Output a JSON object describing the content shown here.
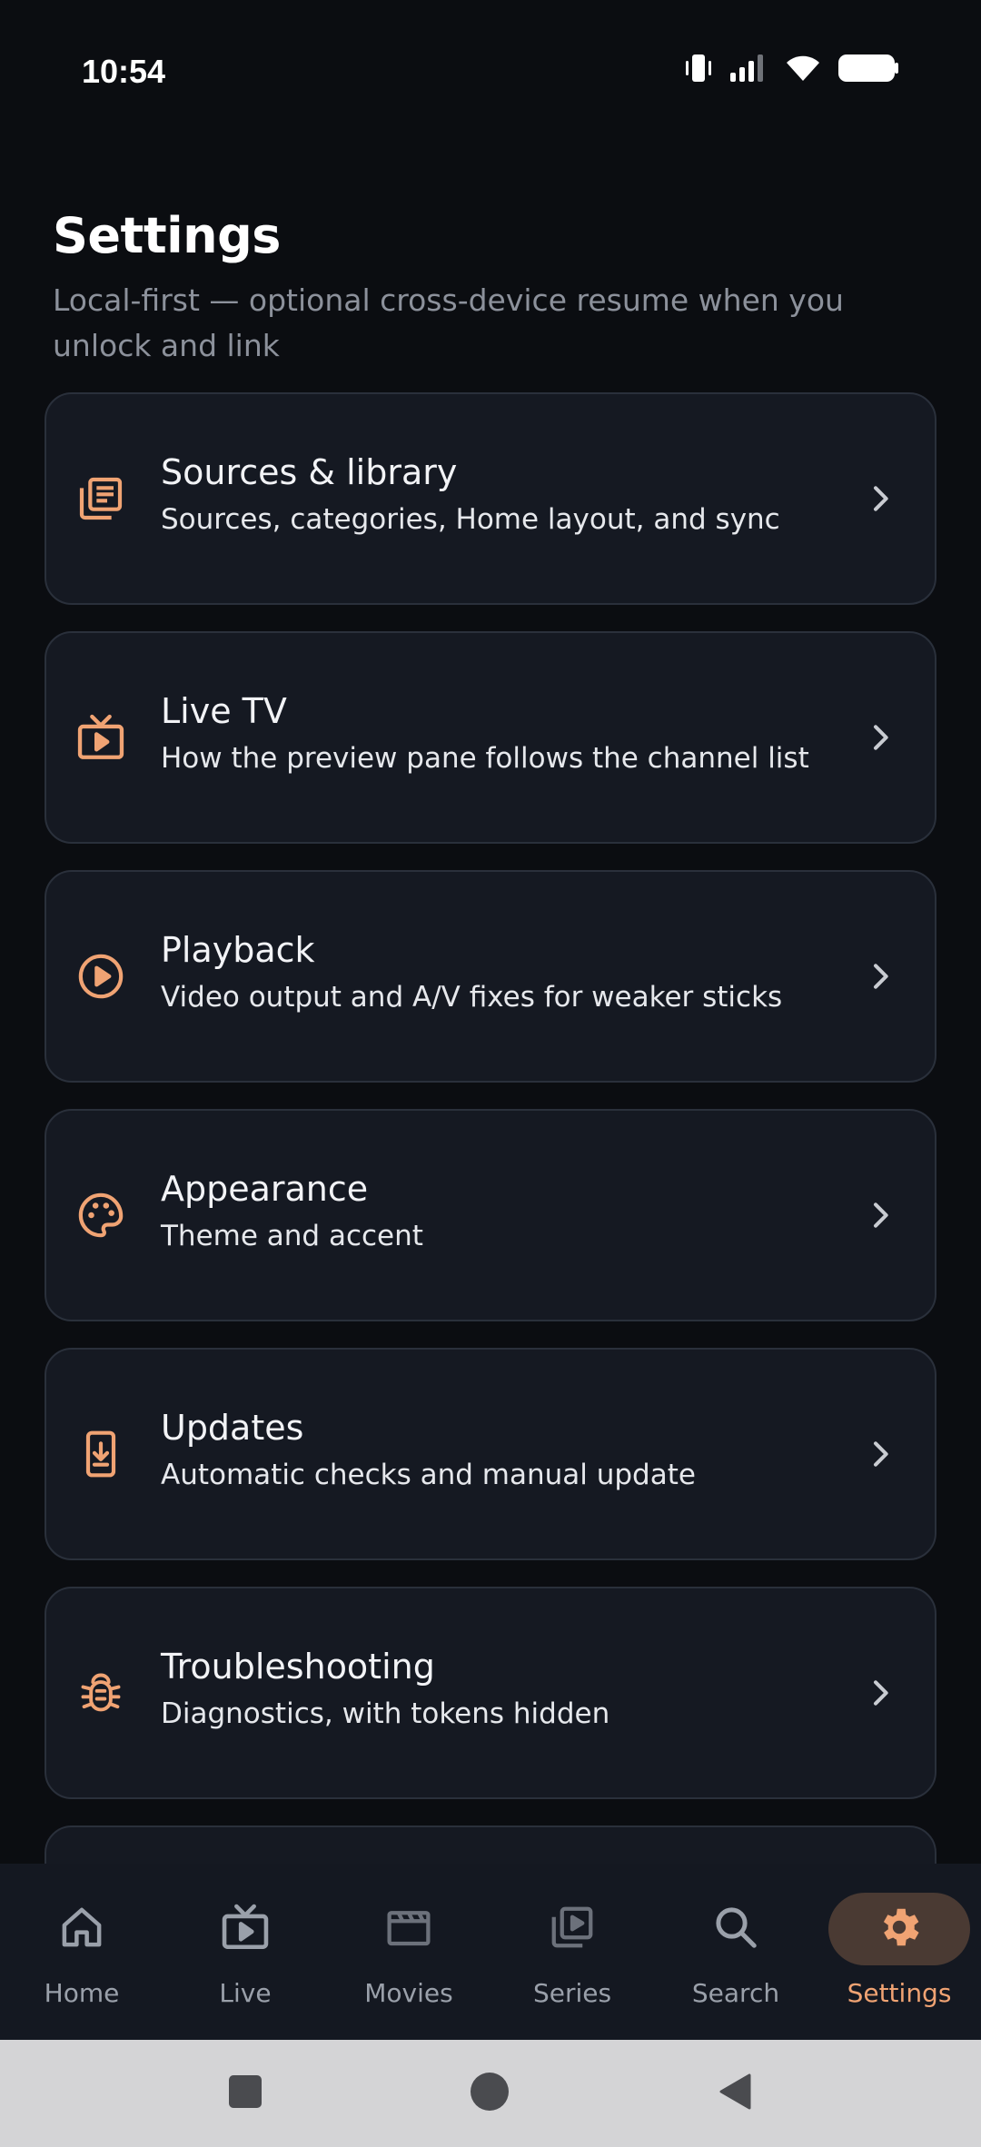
{
  "status_bar": {
    "time": "10:54",
    "icons": [
      "vibrate-icon",
      "signal-icon",
      "wifi-icon",
      "battery-icon"
    ]
  },
  "header": {
    "title": "Settings",
    "subtitle": "Local-first — optional cross-device resume when you unlock and link"
  },
  "settings": {
    "items": [
      {
        "icon": "library-icon",
        "title": "Sources & library",
        "desc": "Sources, categories, Home layout, and sync"
      },
      {
        "icon": "tv-icon",
        "title": "Live TV",
        "desc": "How the preview pane follows the channel list"
      },
      {
        "icon": "play-circle-icon",
        "title": "Playback",
        "desc": "Video output and A/V fixes for weaker sticks"
      },
      {
        "icon": "palette-icon",
        "title": "Appearance",
        "desc": "Theme and accent"
      },
      {
        "icon": "system-update-icon",
        "title": "Updates",
        "desc": "Automatic checks and manual update"
      },
      {
        "icon": "bug-icon",
        "title": "Troubleshooting",
        "desc": "Diagnostics, with tokens hidden"
      }
    ]
  },
  "bottom_nav": {
    "items": [
      {
        "icon": "home-icon",
        "label": "Home"
      },
      {
        "icon": "live-tv-icon",
        "label": "Live"
      },
      {
        "icon": "movie-icon",
        "label": "Movies"
      },
      {
        "icon": "series-icon",
        "label": "Series"
      },
      {
        "icon": "search-icon",
        "label": "Search"
      },
      {
        "icon": "gear-icon",
        "label": "Settings"
      }
    ],
    "active": "Settings"
  },
  "colors": {
    "background": "#0b0d11",
    "card": "#151922",
    "card_border": "#2a303b",
    "accent": "#f0a373",
    "active_pill": "#4a3a33",
    "muted_text": "#8c919b",
    "nav_inactive": "#9aa0aa",
    "system_nav": "#d4d4d6"
  }
}
